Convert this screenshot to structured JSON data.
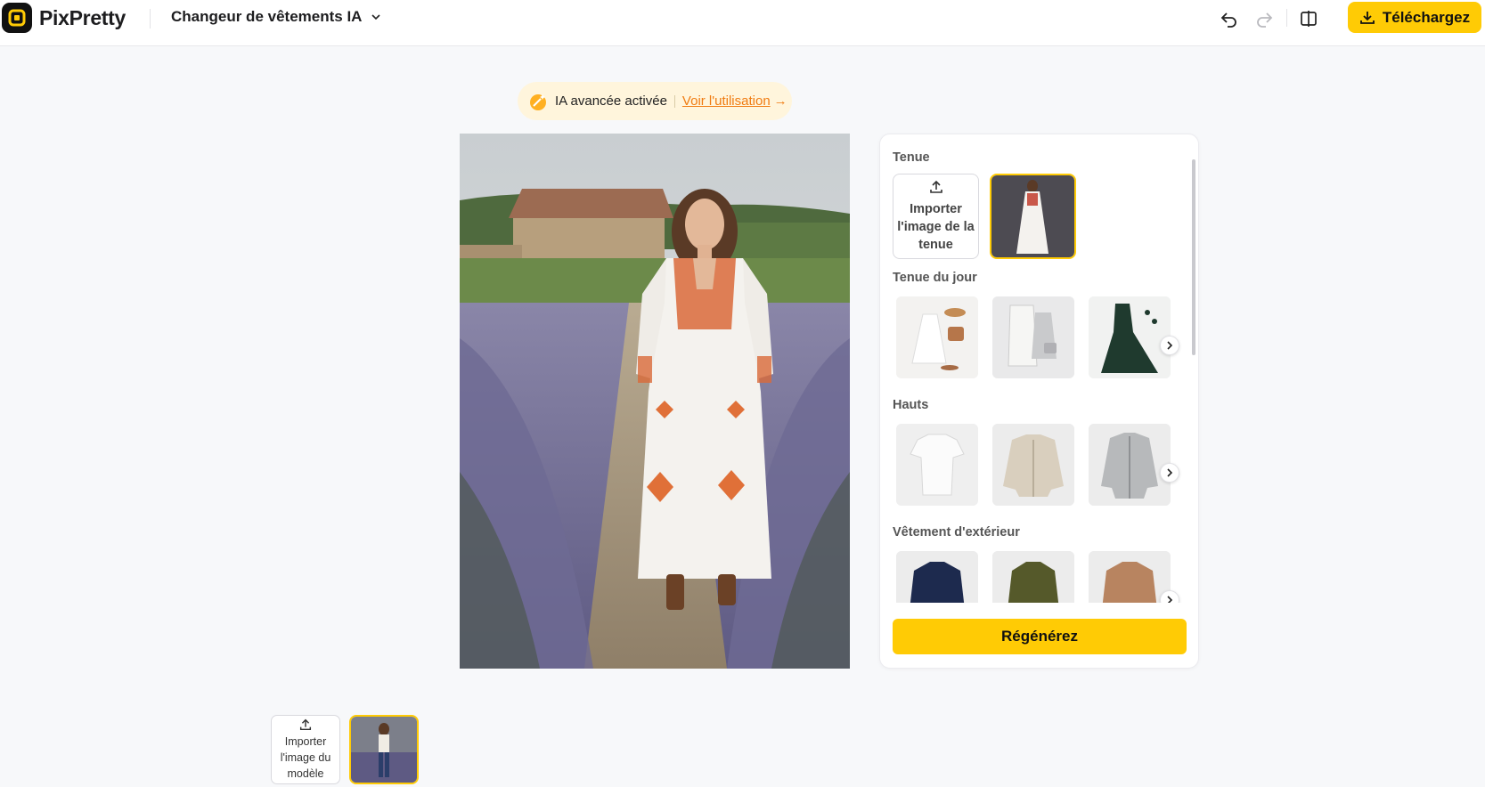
{
  "header": {
    "logo_text": "PixPretty",
    "tool_name": "Changeur de vêtements IA",
    "download_label": "Téléchargez"
  },
  "ai_banner": {
    "text": "IA avancée activée",
    "link": "Voir l'utilisation",
    "arrow": "→"
  },
  "panel": {
    "sections": {
      "outfit": "Tenue",
      "outfit_of_day": "Tenue du jour",
      "tops": "Hauts",
      "outerwear": "Vêtement d'extérieur"
    },
    "upload_outfit": [
      "Importer",
      "l'image de la",
      "tenue"
    ],
    "regenerate_label": "Régénérez"
  },
  "bottom": {
    "upload_model": [
      "Importer",
      "l'image du",
      "modèle"
    ]
  },
  "colors": {
    "accent": "#ffcb05",
    "link": "#f07c12"
  }
}
